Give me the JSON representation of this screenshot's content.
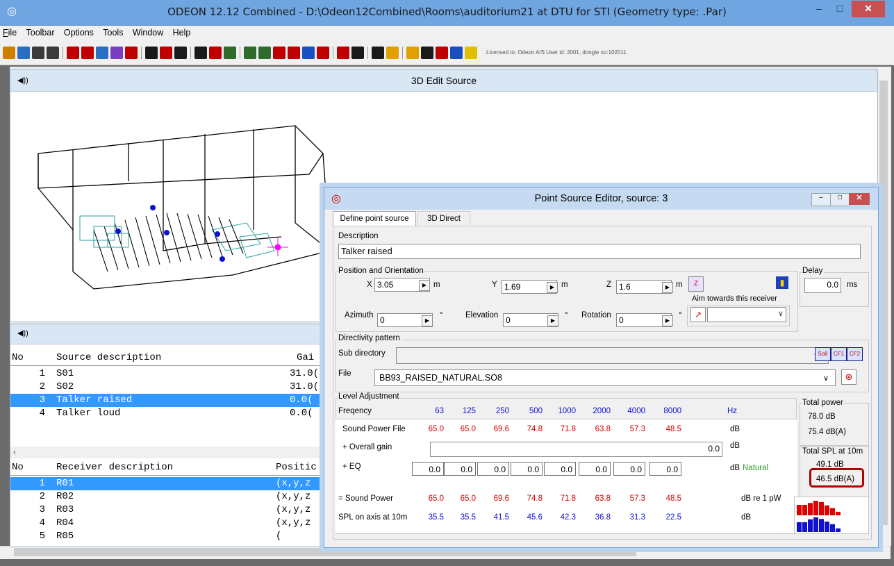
{
  "app": {
    "title": "ODEON 12.12 Combined  -  D:\\Odeon12Combined\\Rooms\\auditorium21 at DTU for STI       (Geometry type: .Par)",
    "min_glyph": "–",
    "max_glyph": "□",
    "close_glyph": "✕",
    "icon_glyph": "◎"
  },
  "menu": [
    "File",
    "Toolbar",
    "Options",
    "Tools",
    "Window",
    "Help"
  ],
  "menu_access_keys": [
    "F",
    "T",
    "O",
    "l",
    "W",
    "H"
  ],
  "toolbar": {
    "license": "Licensed to: Odeon A/S   User id: 2001, dongle no:102011",
    "colors": [
      "#d08000",
      "#2a6fbf",
      "#3a3a3a",
      "#3a3a3a",
      "#c00000",
      "#c00000",
      "#2a6fbf",
      "#7a3fbf",
      "#c00000",
      "#1a1a1a",
      "#c00000",
      "#1a1a1a",
      "#1a1a1a",
      "#c00000",
      "#2f6b2f",
      "#2f6b2f",
      "#2f6b2f",
      "#c00000",
      "#c00000",
      "#1a4fbf",
      "#c00000",
      "#c00000",
      "#1a1a1a",
      "#1a1a1a",
      "#e0a000",
      "#e0a000",
      "#1a1a1a",
      "#c00000",
      "#1a4fbf",
      "#e0c000"
    ]
  },
  "edit3d": {
    "title": "3D Edit Source",
    "icon_glyph": "◀))"
  },
  "sources": {
    "icon_glyph": "◀))",
    "header_no": "No",
    "header_desc": "Source description",
    "header_gain": "Gai",
    "rows": [
      {
        "no": "1",
        "desc": "S01",
        "gain": "31.0("
      },
      {
        "no": "2",
        "desc": "S02",
        "gain": "31.0("
      },
      {
        "no": "3",
        "desc": "Talker raised",
        "gain": "0.0("
      },
      {
        "no": "4",
        "desc": "Talker loud",
        "gain": "0.0("
      }
    ],
    "selected_index": 2
  },
  "receivers": {
    "header_no": "No",
    "header_desc": "Receiver description",
    "header_pos": "Positic",
    "rows": [
      {
        "no": "1",
        "desc": "R01",
        "pos": "(x,y,z"
      },
      {
        "no": "2",
        "desc": "R02",
        "pos": "(x,y,z"
      },
      {
        "no": "3",
        "desc": "R03",
        "pos": "(x,y,z"
      },
      {
        "no": "4",
        "desc": "R04",
        "pos": "(x,y,z"
      },
      {
        "no": "5",
        "desc": "R05",
        "pos": "("
      }
    ],
    "selected_index": 0
  },
  "editor": {
    "title": "Point Source Editor, source: 3",
    "icon_glyph": "◎",
    "tabs": [
      "Define point source",
      "3D Direct"
    ],
    "active_tab": 0,
    "description_label": "Description",
    "description": "Talker raised",
    "position_label": "Position and Orientation",
    "x_label": "X",
    "x": "3.05",
    "y_label": "Y",
    "y": "1.69",
    "z_label": "Z",
    "z": "1.6",
    "unit_m": "m",
    "azimuth_label": "Azimuth",
    "azimuth": "0",
    "elevation_label": "Elevation",
    "elevation": "0",
    "rotation_label": "Rotation",
    "rotation": "0",
    "degree": "°",
    "aim_label": "Aim towards this receiver",
    "aim_value": "",
    "delay_label": "Delay",
    "delay": "0.0",
    "delay_unit": "ms",
    "directivity_label": "Directivity pattern",
    "subdir_label": "Sub directory",
    "subdir": "",
    "file_label": "File",
    "file": "BB93_RAISED_NATURAL.SO8",
    "so8_btns": [
      "So8",
      "CF1",
      "CF2"
    ],
    "level_label": "Level Adjustment",
    "freq_label": "Freqency",
    "freqs": [
      "63",
      "125",
      "250",
      "500",
      "1000",
      "2000",
      "4000",
      "8000"
    ],
    "hz": "Hz",
    "swf_label": "Sound Power File",
    "swf": [
      "65.0",
      "65.0",
      "69.6",
      "74.8",
      "71.8",
      "63.8",
      "57.3",
      "48.5"
    ],
    "db": "dB",
    "gain_label": "+ Overall gain",
    "gain": "0.0",
    "eq_label": "+ EQ",
    "eq": [
      "0.0",
      "0.0",
      "0.0",
      "0.0",
      "0.0",
      "0.0",
      "0.0",
      "0.0"
    ],
    "natural_label": "Natural",
    "sp_label": "= Sound Power",
    "sp": [
      "65.0",
      "65.0",
      "69.6",
      "74.8",
      "71.8",
      "63.8",
      "57.3",
      "48.5"
    ],
    "sp_unit": "dB re 1 pW",
    "spl_label": "SPL on axis at 10m",
    "spl": [
      "35.5",
      "35.5",
      "41.5",
      "45.6",
      "42.3",
      "36.8",
      "31.3",
      "22.5"
    ],
    "total_power_label": "Total power",
    "total_power_db": "78.0 dB",
    "total_power_dba": "75.4 dB(A)",
    "total_spl_label": "Total SPL at 10m",
    "total_spl_db": "49.1 dB",
    "total_spl_dba": "46.5 dB(A)",
    "highlight_color": "#b00000"
  }
}
